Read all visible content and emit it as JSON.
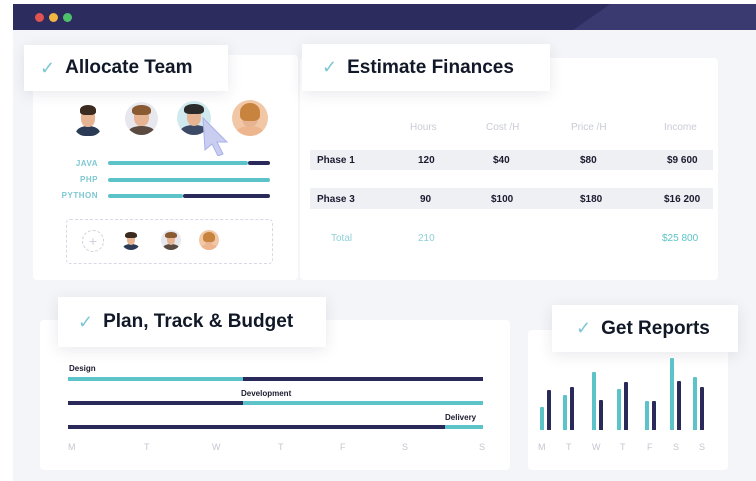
{
  "colors": {
    "navy": "#2d2c5f",
    "teal": "#5cc3c8",
    "dark": "#2a2a5a"
  },
  "allocate": {
    "title": "Allocate Team",
    "skills": [
      {
        "label": "JAVA"
      },
      {
        "label": "PHP"
      },
      {
        "label": "PYTHON"
      }
    ]
  },
  "finances": {
    "title": "Estimate Finances",
    "headers": [
      "Hours",
      "Cost /H",
      "Price /H",
      "Income"
    ],
    "rows": [
      {
        "phase": "Phase 1",
        "hours": "120",
        "cost": "$40",
        "price": "$80",
        "income": "$9 600"
      },
      {
        "phase": "Phase 3",
        "hours": "90",
        "cost": "$100",
        "price": "$180",
        "income": "$16 200"
      }
    ],
    "total": {
      "label": "Total",
      "hours": "210",
      "income": "$25 800"
    }
  },
  "plan": {
    "title": "Plan, Track & Budget",
    "tasks": [
      "Design",
      "Development",
      "Delivery"
    ],
    "days": [
      "M",
      "T",
      "W",
      "T",
      "F",
      "S",
      "S"
    ]
  },
  "reports": {
    "title": "Get Reports",
    "days": [
      "M",
      "T",
      "W",
      "T",
      "F",
      "S",
      "S"
    ]
  },
  "icons": {
    "check": "check-icon",
    "cursor": "cursor-icon",
    "add": "add-icon"
  }
}
